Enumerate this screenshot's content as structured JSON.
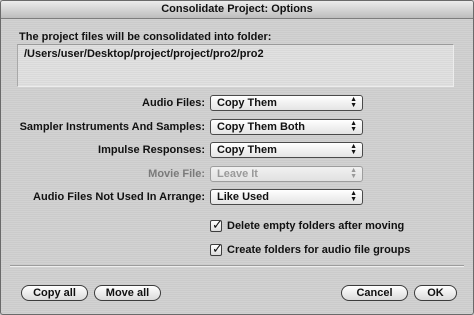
{
  "window": {
    "title": "Consolidate Project: Options"
  },
  "description": "The project files will be consolidated into folder:",
  "path": "/Users/user/Desktop/project/project/pro2/pro2",
  "options": [
    {
      "label": "Audio Files:",
      "value": "Copy Them",
      "enabled": true
    },
    {
      "label": "Sampler Instruments And Samples:",
      "value": "Copy Them Both",
      "enabled": true
    },
    {
      "label": "Impulse Responses:",
      "value": "Copy Them",
      "enabled": true
    },
    {
      "label": "Movie File:",
      "value": "Leave It",
      "enabled": false
    },
    {
      "label": "Audio Files Not Used In Arrange:",
      "value": "Like Used",
      "enabled": true
    }
  ],
  "checkboxes": [
    {
      "label": "Delete empty folders after moving",
      "checked": true
    },
    {
      "label": "Create folders for audio file groups",
      "checked": true
    }
  ],
  "buttons": {
    "copy_all": "Copy all",
    "move_all": "Move all",
    "cancel": "Cancel",
    "ok": "OK"
  },
  "icons": {
    "popup_arrows": "up-down-arrows-icon",
    "checkmark": "checkmark-icon"
  }
}
